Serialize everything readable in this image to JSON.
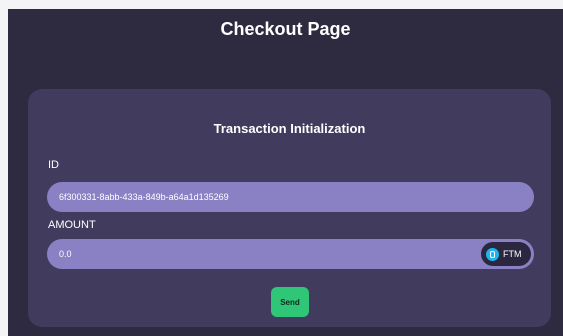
{
  "header": {
    "title": "Checkout Page"
  },
  "card": {
    "title": "Transaction Initialization",
    "id_field": {
      "label": "ID",
      "value": "6f300331-8abb-433a-849b-a64a1d135269"
    },
    "amount_field": {
      "label": "AMOUNT",
      "value": "0.0",
      "token": {
        "label": "FTM",
        "icon": "fantom-token-icon",
        "icon_color": "#1db4f0"
      }
    },
    "send_button": {
      "label": "Send",
      "color": "#2fc777"
    }
  },
  "colors": {
    "background": "#2e2a3f",
    "card": "#413c5e",
    "input": "#8a80c4"
  }
}
